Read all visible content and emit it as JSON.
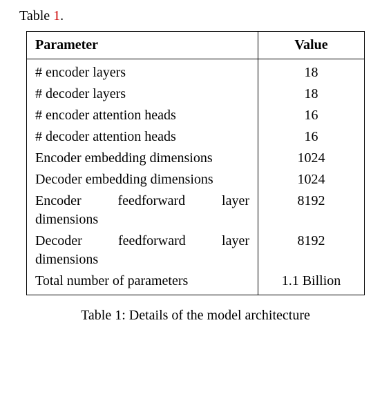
{
  "pretext_prefix": "Table ",
  "pretext_ref": "1",
  "pretext_suffix": ".",
  "table": {
    "headers": {
      "param": "Parameter",
      "value": "Value"
    },
    "rows": [
      {
        "param": "# encoder layers",
        "value": "18"
      },
      {
        "param": "# decoder layers",
        "value": "18"
      },
      {
        "param": "# encoder attention heads",
        "value": "16"
      },
      {
        "param": "# decoder attention heads",
        "value": "16"
      },
      {
        "param": "Encoder embedding dimensions",
        "value": "1024"
      },
      {
        "param": "Decoder embedding dimen­sions",
        "value": "1024"
      },
      {
        "param": "Encoder feedforward layer dimensions",
        "value": "8192"
      },
      {
        "param": "Decoder feedforward layer dimensions",
        "value": "8192"
      },
      {
        "param": "Total number of parameters",
        "value": "1.1 Billion"
      }
    ]
  },
  "caption": "Table 1: Details of the model architecture"
}
